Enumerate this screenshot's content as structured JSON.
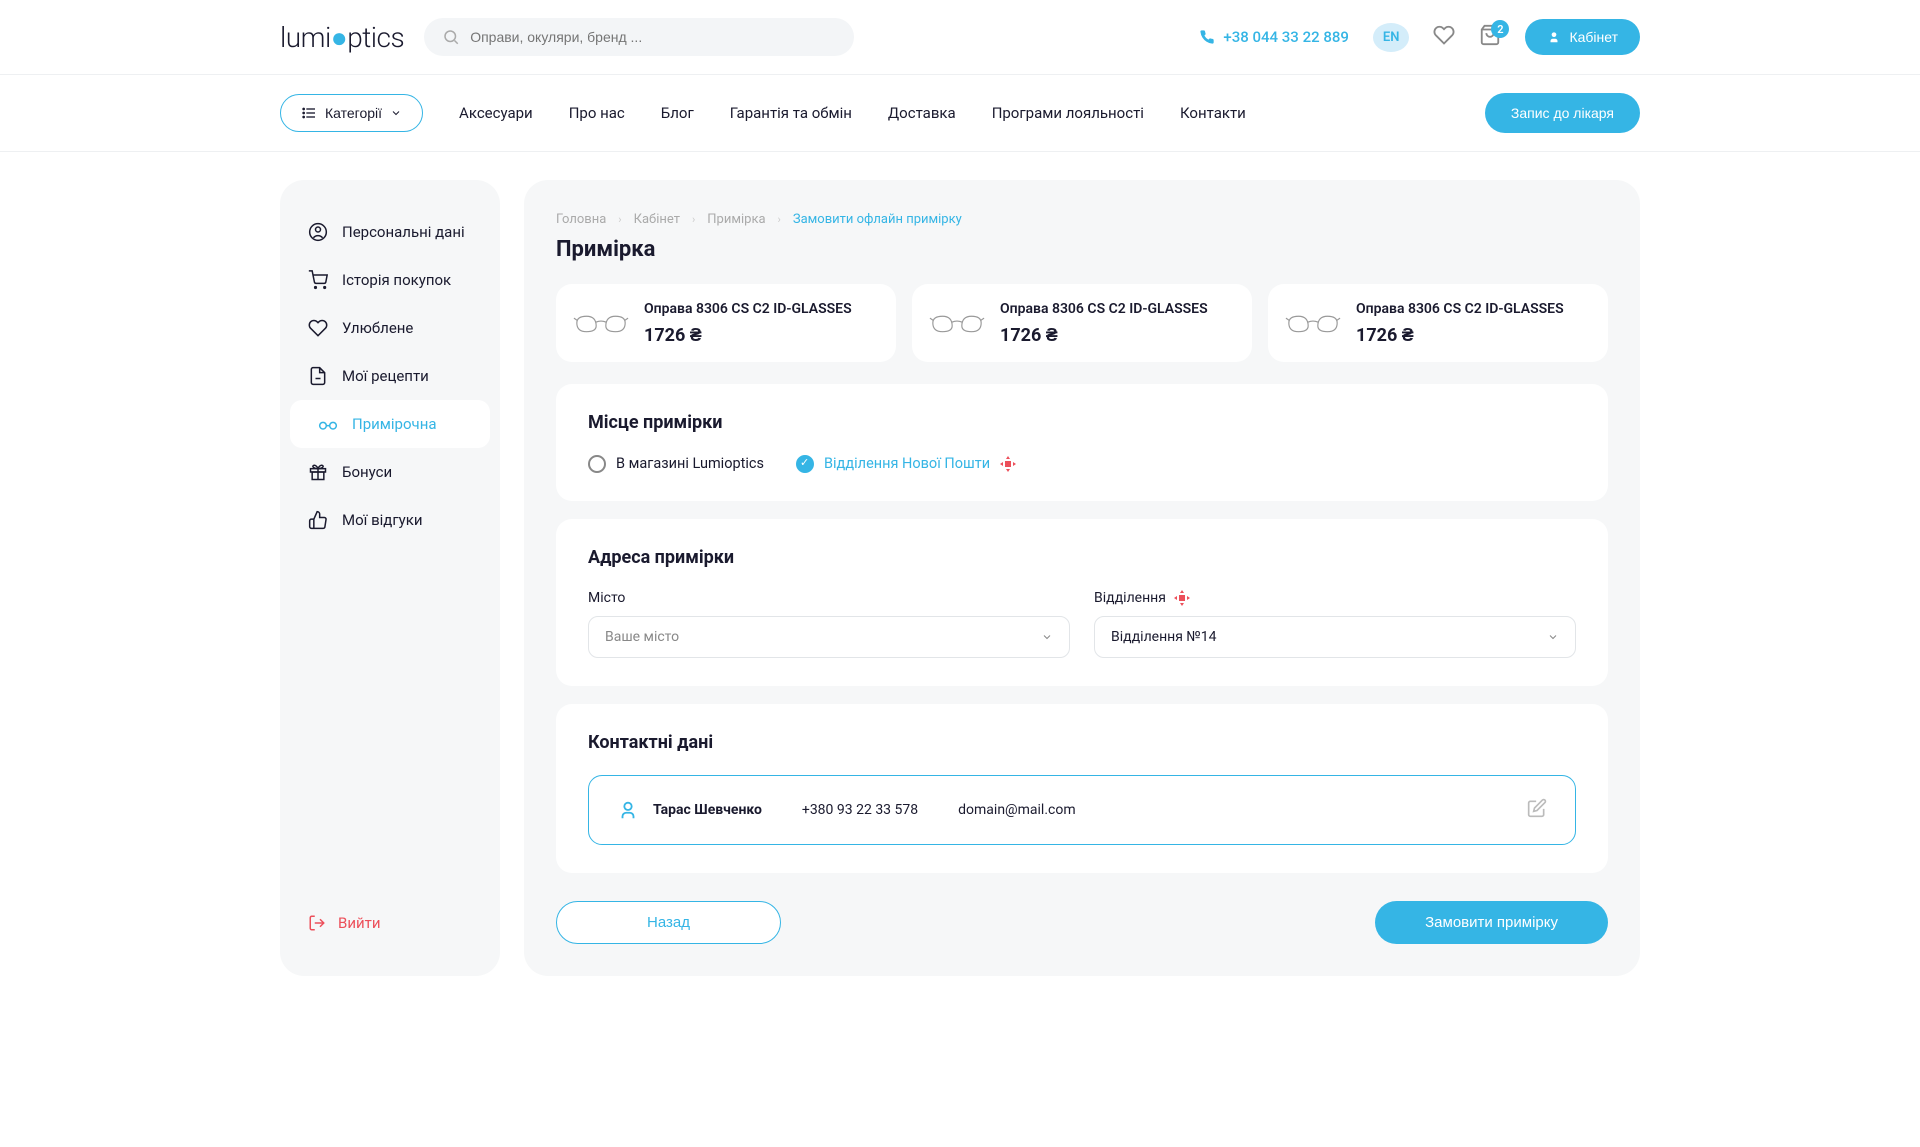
{
  "header": {
    "search_placeholder": "Оправи, окуляри, бренд ...",
    "phone": "+38 044 33 22 889",
    "lang": "EN",
    "cart_count": "2",
    "cabinet_label": "Кабінет"
  },
  "nav": {
    "categories_label": "Категорії",
    "items": [
      "Аксесуари",
      "Про нас",
      "Блог",
      "Гарантія та обмін",
      "Доставка",
      "Програми лояльності",
      "Контакти"
    ],
    "doctor_label": "Запис до лікаря"
  },
  "sidebar": {
    "items": [
      {
        "label": "Персональні дані"
      },
      {
        "label": "Історія покупок"
      },
      {
        "label": "Улюблене"
      },
      {
        "label": "Мої рецепти"
      },
      {
        "label": "Примірочна"
      },
      {
        "label": "Бонуси"
      },
      {
        "label": "Мої відгуки"
      }
    ],
    "logout_label": "Вийти"
  },
  "breadcrumbs": [
    "Головна",
    "Кабінет",
    "Примірка",
    "Замовити офлайн примірку"
  ],
  "page_title": "Примірка",
  "products": [
    {
      "name": "Оправа 8306 CS C2 ID-GLASSES",
      "price": "1726 ₴"
    },
    {
      "name": "Оправа 8306 CS C2 ID-GLASSES",
      "price": "1726 ₴"
    },
    {
      "name": "Оправа 8306 CS C2 ID-GLASSES",
      "price": "1726 ₴"
    }
  ],
  "location": {
    "title": "Місце примірки",
    "opt1": "В магазині Lumioptics",
    "opt2": "Відділення Нової Пошти"
  },
  "address": {
    "title": "Адреса примірки",
    "city_label": "Місто",
    "city_placeholder": "Ваше місто",
    "branch_label": "Відділення",
    "branch_value": "Відділення №14"
  },
  "contact": {
    "title": "Контактні дані",
    "name": "Тарас Шевченко",
    "phone": "+380 93 22 33 578",
    "email": "domain@mail.com"
  },
  "actions": {
    "back": "Назад",
    "submit": "Замовити примірку"
  }
}
